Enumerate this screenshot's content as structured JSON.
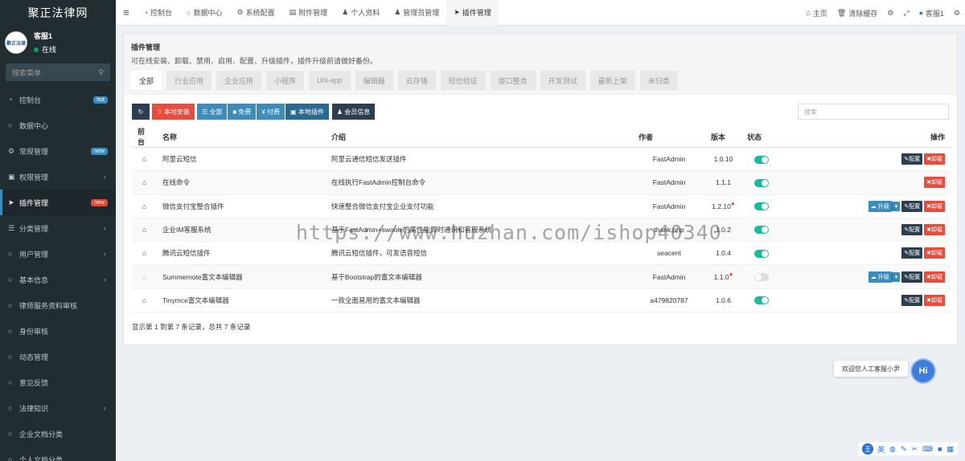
{
  "sidebar": {
    "brand": "聚正法律网",
    "user": {
      "avatar_text": "聚正法律",
      "name": "客服1",
      "status": "在线"
    },
    "search_placeholder": "搜索菜单",
    "items": [
      {
        "icon": "dashboard-icon",
        "label": "控制台",
        "badge": "hot",
        "badge_color": "#3c8dbc"
      },
      {
        "icon": "circle-icon",
        "label": "数据中心"
      },
      {
        "icon": "cogs-icon",
        "label": "常规管理",
        "badge": "new",
        "badge_color": "#3c8dbc"
      },
      {
        "icon": "group-icon",
        "label": "权限管理",
        "chevron": "‹"
      },
      {
        "icon": "rocket-icon",
        "label": "插件管理",
        "badge": "new",
        "badge_color": "#dd4b39",
        "active": true
      },
      {
        "icon": "list-icon",
        "label": "分类管理",
        "chevron": "‹"
      },
      {
        "icon": "circle-icon",
        "label": "用户管理",
        "chevron": "‹"
      },
      {
        "icon": "circle-icon",
        "label": "基本信息",
        "chevron": "‹"
      },
      {
        "icon": "circle-icon",
        "label": "律师服务资料审核"
      },
      {
        "icon": "circle-icon",
        "label": "身份审核"
      },
      {
        "icon": "circle-icon",
        "label": "动态管理"
      },
      {
        "icon": "circle-icon",
        "label": "意见反馈"
      },
      {
        "icon": "circle-icon",
        "label": "法律知识",
        "chevron": "‹"
      },
      {
        "icon": "circle-icon",
        "label": "企业文档分类"
      },
      {
        "icon": "circle-icon",
        "label": "个人文档分类"
      }
    ]
  },
  "topbar": {
    "menu_icon": "≡",
    "tabs": [
      {
        "icon": "dashboard-icon",
        "label": "控制台"
      },
      {
        "icon": "circle-icon",
        "label": "数据中心"
      },
      {
        "icon": "cog-icon",
        "label": "系统配置"
      },
      {
        "icon": "file-icon",
        "label": "附件管理"
      },
      {
        "icon": "user-icon",
        "label": "个人资料"
      },
      {
        "icon": "user-icon",
        "label": "管理员管理"
      },
      {
        "icon": "rocket-icon",
        "label": "插件管理",
        "active": true
      }
    ],
    "right": {
      "home": "主页",
      "clear_cache": "清除缓存",
      "user_name": "客服1"
    }
  },
  "panel": {
    "title": "插件管理",
    "description": "可在线安装、卸载、禁用、启用、配置、升级插件，插件升级前请做好备份。",
    "tabs": [
      "全部",
      "行业应用",
      "企业应用",
      "小程序",
      "Uni-app",
      "编辑器",
      "云存储",
      "短信验证",
      "接口整合",
      "开发测试",
      "最新上架",
      "未归类"
    ],
    "toolbar": {
      "local_install": "本地安装",
      "all": "全部",
      "free": "免费",
      "paid": "付费",
      "local_plugins": "本地插件",
      "member_info": "会员信息"
    },
    "search_placeholder": "搜索",
    "columns": {
      "front": "前台",
      "name": "名称",
      "intro": "介绍",
      "author": "作者",
      "version": "版本",
      "status": "状态",
      "ops": "操作"
    },
    "rows": [
      {
        "name": "阿里云短信",
        "intro": "阿里云通信短信发送插件",
        "author": "FastAdmin",
        "version": "1.0.10",
        "enabled": true,
        "upgrade": false,
        "config": true,
        "front_active": true
      },
      {
        "name": "在线命令",
        "intro": "在线执行FastAdmin控制台命令",
        "author": "FastAdmin",
        "version": "1.1.1",
        "enabled": true,
        "upgrade": false,
        "config": false,
        "front_active": true
      },
      {
        "name": "微信支付宝整合插件",
        "intro": "快速整合微信支付宝企业支付功能",
        "author": "FastAdmin",
        "version": "1.2.10",
        "enabled": true,
        "upgrade": true,
        "config": true,
        "front_active": true,
        "new_version": true
      },
      {
        "name": "企业IM客服系统",
        "intro": "基于FastAdmin+swoole的高性能即时通讯和客服系统",
        "author": "thank.php",
        "version": "1.0.2",
        "enabled": true,
        "upgrade": false,
        "config": true,
        "front_active": true
      },
      {
        "name": "腾讯云短信插件",
        "intro": "腾讯云短信插件，可发语音短信",
        "author": "seacent",
        "version": "1.0.4",
        "enabled": true,
        "upgrade": false,
        "config": true,
        "front_active": true
      },
      {
        "name": "Summernote富文本编辑器",
        "intro": "基于Bootstrap的富文本编辑器",
        "author": "FastAdmin",
        "version": "1.1.0",
        "enabled": false,
        "upgrade": true,
        "config": true,
        "front_active": false,
        "new_version": true
      },
      {
        "name": "Tinymce富文本编辑器",
        "intro": "一款全面易用的富文本编辑器",
        "author": "a479820787",
        "version": "1.0.6",
        "enabled": true,
        "upgrade": false,
        "config": true,
        "front_active": true
      }
    ],
    "op_labels": {
      "config": "配置",
      "uninstall": "卸载",
      "upgrade": "升级"
    },
    "footer": "显示第 1 到第 7 条记录，总共 7 条记录"
  },
  "watermark": "https://www.huzhan.com/ishop40340",
  "chat": {
    "greeting": "欢迎您人工客服小尹",
    "button": "Hi"
  },
  "ime": {
    "logo": "王",
    "lang": "英"
  },
  "colors": {
    "sidebar_bg": "#222d32",
    "accent": "#3c8dbc",
    "danger": "#e74c3c",
    "success": "#18bc9c"
  }
}
